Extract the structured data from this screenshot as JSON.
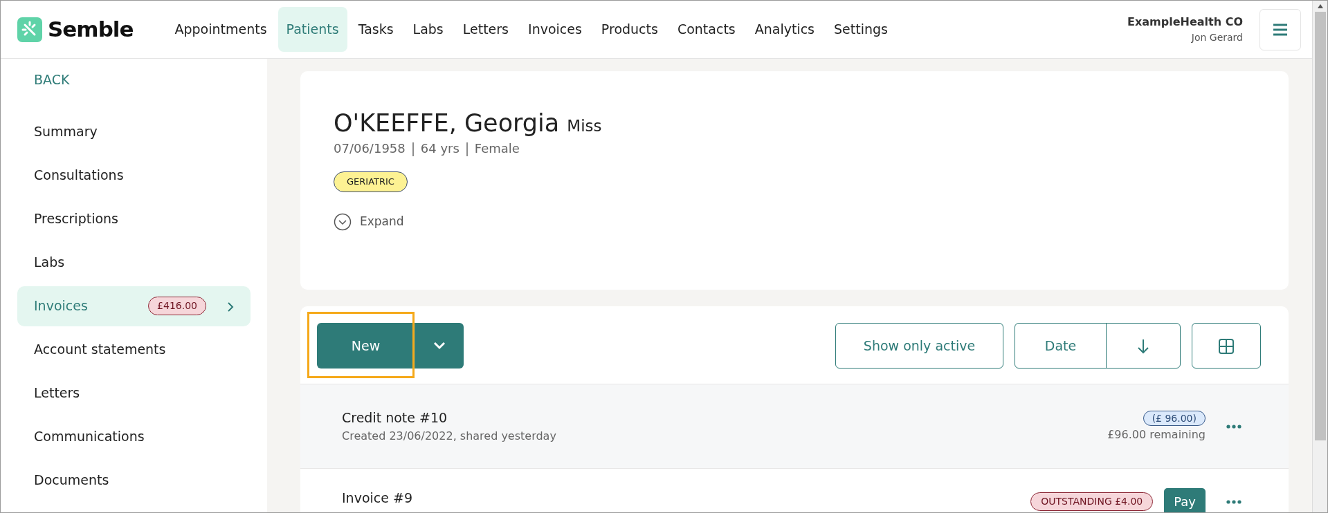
{
  "brand": {
    "name": "Semble"
  },
  "nav": [
    {
      "label": "Appointments",
      "selected": false
    },
    {
      "label": "Patients",
      "selected": true
    },
    {
      "label": "Tasks",
      "selected": false
    },
    {
      "label": "Labs",
      "selected": false
    },
    {
      "label": "Letters",
      "selected": false
    },
    {
      "label": "Invoices",
      "selected": false
    },
    {
      "label": "Products",
      "selected": false
    },
    {
      "label": "Contacts",
      "selected": false
    },
    {
      "label": "Analytics",
      "selected": false
    },
    {
      "label": "Settings",
      "selected": false
    }
  ],
  "account": {
    "organisation": "ExampleHealth CO",
    "user": "Jon Gerard"
  },
  "sidebar": {
    "back": "BACK",
    "items": [
      {
        "label": "Summary",
        "selected": false
      },
      {
        "label": "Consultations",
        "selected": false
      },
      {
        "label": "Prescriptions",
        "selected": false
      },
      {
        "label": "Labs",
        "selected": false
      },
      {
        "label": "Invoices",
        "selected": true,
        "badge": "£416.00"
      },
      {
        "label": "Account statements",
        "selected": false
      },
      {
        "label": "Letters",
        "selected": false
      },
      {
        "label": "Communications",
        "selected": false
      },
      {
        "label": "Documents",
        "selected": false
      }
    ]
  },
  "patient": {
    "name": "O'KEEFFE, Georgia",
    "title": "Miss",
    "details": [
      "07/06/1958",
      "64 yrs",
      "Female"
    ],
    "tags": [
      "GERIATRIC"
    ],
    "expand": "Expand"
  },
  "toolbar": {
    "new_button": {
      "label": "New",
      "highlighted": true
    },
    "filter": "Show only active",
    "sort": "Date"
  },
  "invoices": [
    {
      "kind": "credit",
      "title": "Credit note #10",
      "subtitle": "Created 23/06/2022, shared yesterday",
      "badge": "(£ 96.00)",
      "remaining": "£96.00 remaining"
    },
    {
      "kind": "invoice",
      "title": "Invoice #9",
      "badge": "OUTSTANDING £4.00",
      "action": "Pay"
    }
  ]
}
